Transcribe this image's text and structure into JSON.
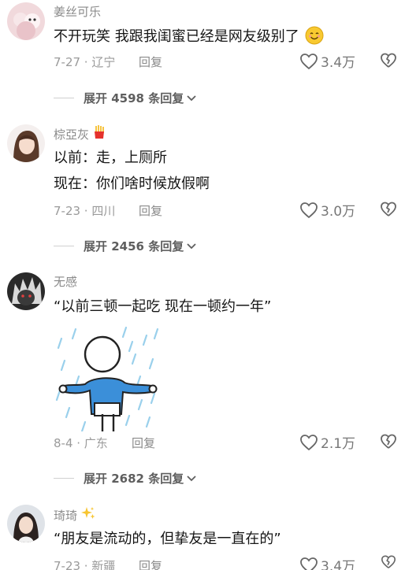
{
  "comments": [
    {
      "username": "姜丝可乐",
      "text": [
        "不开玩笑 我跟我闺蜜已经是网友级别了"
      ],
      "meta": "7-27 · 辽宁",
      "reply_label": "回复",
      "likes": "3.4万",
      "expand_label": "展开 4598 条回复"
    },
    {
      "username": "棕亞灰",
      "text": [
        "以前：走，上厕所",
        "现在：你们啥时候放假啊"
      ],
      "meta": "7-23 · 四川",
      "reply_label": "回复",
      "likes": "3.0万",
      "expand_label": "展开 2456 条回复"
    },
    {
      "username": "无感",
      "text": [
        "“以前三顿一起吃 现在一顿约一年”"
      ],
      "meta": "8-4 · 广东",
      "reply_label": "回复",
      "likes": "2.1万",
      "expand_label": "展开 2682 条回复"
    },
    {
      "username": "琦琦",
      "text": [
        "“朋友是流动的，但挚友是一直在的”"
      ],
      "meta": "7-23 · 新疆",
      "reply_label": "回复",
      "likes": "3.4万"
    }
  ],
  "icons": {
    "like": "heart-outline-icon",
    "dislike": "broken-heart-icon",
    "expand": "chevron-down-icon",
    "emoji": "smiling-face-emoji",
    "fries": "french-fries-emoji",
    "sparkles": "sparkles-emoji"
  },
  "colors": {
    "username": "#8a8a8a",
    "text": "#161616",
    "meta": "#9a9a9a"
  }
}
